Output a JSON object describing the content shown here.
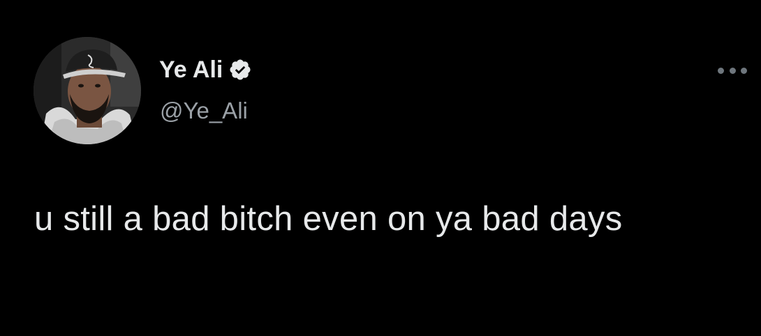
{
  "tweet": {
    "author": {
      "display_name": "Ye Ali",
      "handle": "@Ye_Ali",
      "verified": true,
      "avatar_icon": "user-avatar-photo"
    },
    "more_icon": "ellipsis-icon",
    "text": "u still a bad bitch even on ya bad days"
  },
  "colors": {
    "background": "#000000",
    "primary_text": "#e7e9ea",
    "secondary_text": "#9aa0a6",
    "verified_badge": "#e7e9ea",
    "more_icon": "#6e767d"
  }
}
